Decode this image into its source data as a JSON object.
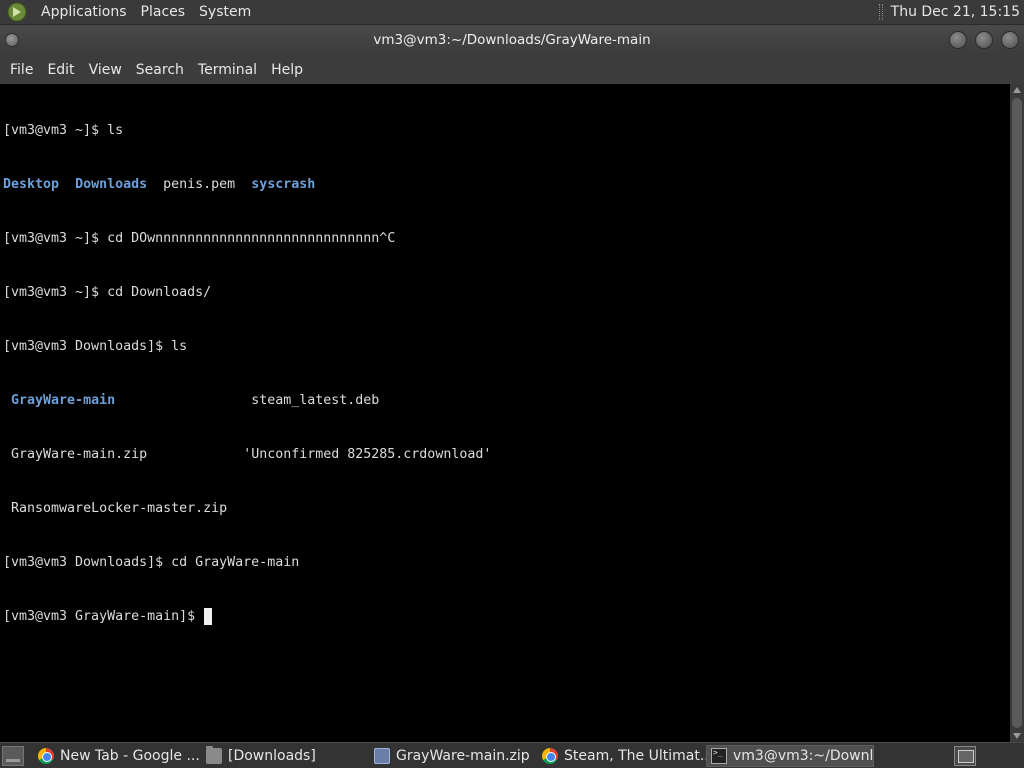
{
  "top_panel": {
    "menus": [
      "Applications",
      "Places",
      "System"
    ],
    "clock": "Thu Dec 21, 15:15"
  },
  "window": {
    "title": "vm3@vm3:~/Downloads/GrayWare-main"
  },
  "menubar": {
    "items": [
      "File",
      "Edit",
      "View",
      "Search",
      "Terminal",
      "Help"
    ]
  },
  "terminal": {
    "lines": [
      {
        "prompt": "[vm3@vm3 ~]$ ",
        "command": "ls"
      },
      {
        "entries": [
          "Desktop",
          "Downloads",
          "penis.pem",
          "syscrash"
        ]
      },
      {
        "prompt": "[vm3@vm3 ~]$ ",
        "command": "cd DOwnnnnnnnnnnnnnnnnnnnnnnnnnnnn^C"
      },
      {
        "prompt": "[vm3@vm3 ~]$ ",
        "command": "cd Downloads/"
      },
      {
        "prompt": "[vm3@vm3 Downloads]$ ",
        "command": "ls"
      },
      {
        "entries": [
          "GrayWare-main",
          "steam_latest.deb"
        ]
      },
      {
        "entries": [
          "GrayWare-main.zip",
          "'Unconfirmed 825285.crdownload'"
        ]
      },
      {
        "entries": [
          "RansomwareLocker-master.zip"
        ]
      },
      {
        "prompt": "[vm3@vm3 Downloads]$ ",
        "command": "cd GrayWare-main"
      },
      {
        "prompt": "[vm3@vm3 GrayWare-main]$ ",
        "command": ""
      }
    ]
  },
  "taskbar": {
    "tasks": [
      {
        "label": "New Tab - Google ...",
        "icon": "chrome-icon"
      },
      {
        "label": "[Downloads]",
        "icon": "folder-icon"
      },
      {
        "label": "GrayWare-main.zip",
        "icon": "archive-icon"
      },
      {
        "label": "Steam, The Ultimat...",
        "icon": "chrome-icon"
      },
      {
        "label": "vm3@vm3:~/Downl...",
        "icon": "terminal-icon"
      }
    ]
  },
  "colors": {
    "directory": "#6f9fd6",
    "terminal_bg": "#000000",
    "terminal_fg": "#dcdcdc"
  }
}
